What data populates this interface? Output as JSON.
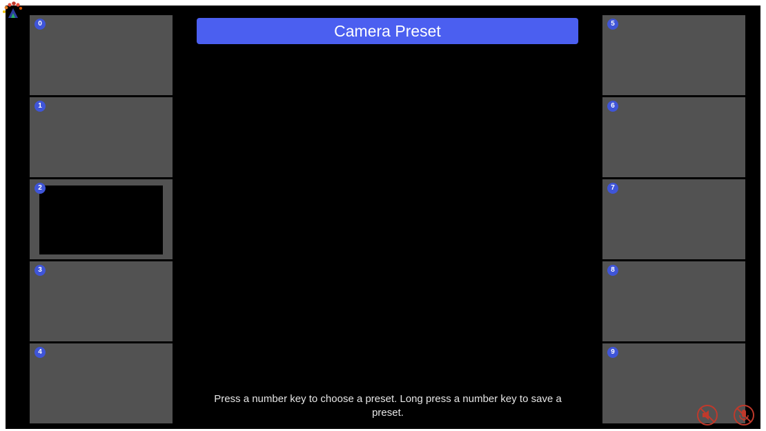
{
  "header": {
    "title": "Camera Preset"
  },
  "instructions": "Press a number key to choose a preset. Long press a number key to save a preset.",
  "presets": [
    {
      "label": "0",
      "selected": false
    },
    {
      "label": "1",
      "selected": false
    },
    {
      "label": "2",
      "selected": true
    },
    {
      "label": "3",
      "selected": false
    },
    {
      "label": "4",
      "selected": false
    },
    {
      "label": "5",
      "selected": false
    },
    {
      "label": "6",
      "selected": false
    },
    {
      "label": "7",
      "selected": false
    },
    {
      "label": "8",
      "selected": false
    },
    {
      "label": "9",
      "selected": false
    }
  ],
  "status_icons": [
    "speaker-muted-icon",
    "microphone-muted-icon"
  ],
  "colors": {
    "accent": "#4b5ff0",
    "badge": "#3f55d8",
    "tile": "#525252",
    "alert": "#c0392b"
  }
}
